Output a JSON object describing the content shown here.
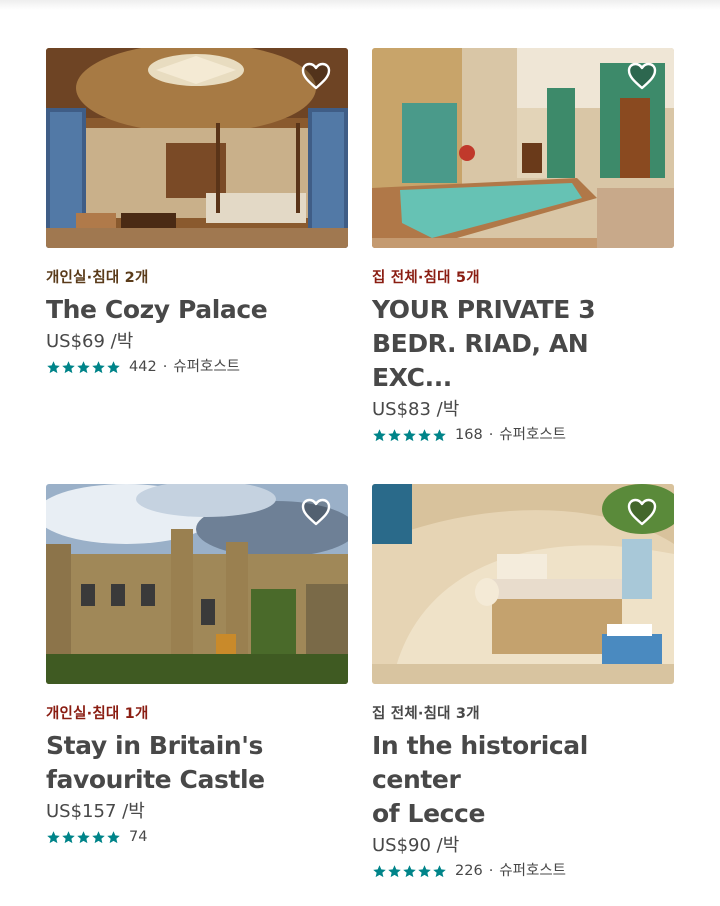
{
  "theme": {
    "kicker_color_brown": "#5a3b1a",
    "kicker_color_red": "#8a1d12",
    "kicker_color_dark": "#484848",
    "star_color": "#008489"
  },
  "listings": [
    {
      "kicker": "개인실·침대 2개",
      "title_lines": [
        "The Cozy Palace"
      ],
      "price": "US$69 /박",
      "reviews": "442",
      "separator": "·",
      "superhost": "슈퍼호스트",
      "heart_icon": "heart-outline-icon"
    },
    {
      "kicker": "집 전체·침대 5개",
      "title_lines": [
        "YOUR PRIVATE 3",
        "BEDR. RIAD, AN EXC..."
      ],
      "price": "US$83 /박",
      "reviews": "168",
      "separator": "·",
      "superhost": "슈퍼호스트",
      "heart_icon": "heart-outline-icon"
    },
    {
      "kicker": "개인실·침대 1개",
      "title_lines": [
        "Stay in Britain's",
        "favourite Castle"
      ],
      "price": "US$157 /박",
      "reviews": "74",
      "heart_icon": "heart-outline-icon"
    },
    {
      "kicker": "집 전체·침대 3개",
      "title_lines": [
        "In the historical center",
        "of Lecce"
      ],
      "price": "US$90 /박",
      "reviews": "226",
      "separator": "·",
      "superhost": "슈퍼호스트",
      "heart_icon": "heart-outline-icon"
    }
  ]
}
